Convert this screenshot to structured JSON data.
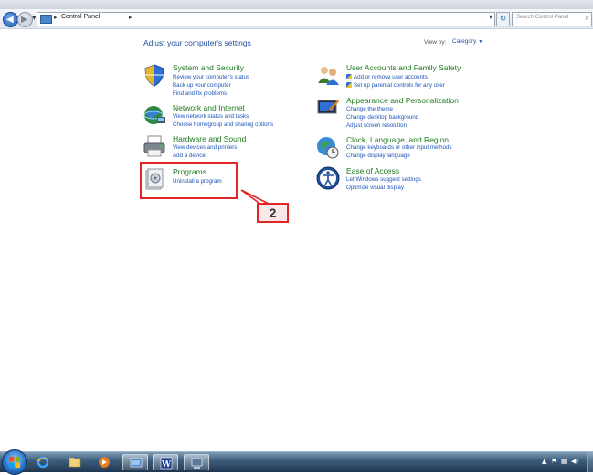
{
  "address_bar": {
    "breadcrumb": "Control Panel",
    "search_placeholder": "Search Control Panel"
  },
  "header": {
    "title": "Adjust your computer's settings",
    "view_by_label": "View by:",
    "view_by_value": "Category"
  },
  "categories_left": [
    {
      "title": "System and Security",
      "links": [
        "Review your computer's status",
        "Back up your computer",
        "Find and fix problems"
      ]
    },
    {
      "title": "Network and Internet",
      "links": [
        "View network status and tasks",
        "Choose homegroup and sharing options"
      ]
    },
    {
      "title": "Hardware and Sound",
      "links": [
        "View devices and printers",
        "Add a device"
      ]
    },
    {
      "title": "Programs",
      "links": [
        "Uninstall a program"
      ]
    }
  ],
  "categories_right": [
    {
      "title": "User Accounts and Family Safety",
      "links": [
        "Add or remove user accounts",
        "Set up parental controls for any user"
      ]
    },
    {
      "title": "Appearance and Personalization",
      "links": [
        "Change the theme",
        "Change desktop background",
        "Adjust screen resolution"
      ]
    },
    {
      "title": "Clock, Language, and Region",
      "links": [
        "Change keyboards or other input methods",
        "Change display language"
      ]
    },
    {
      "title": "Ease of Access",
      "links": [
        "Let Windows suggest settings",
        "Optimize visual display"
      ]
    }
  ],
  "annotation": {
    "step_number": "2",
    "highlight_color": "#e12525"
  },
  "taskbar": {
    "items": [
      "internet-explorer",
      "windows-explorer",
      "media-player",
      "control-panel",
      "word",
      "network-window"
    ],
    "tray_icons": [
      "show-hidden-icons",
      "action-center",
      "network",
      "volume"
    ]
  },
  "colors": {
    "heading": "#1e4f9a",
    "category_title": "#1f7a1f",
    "link": "#1c55b7"
  }
}
